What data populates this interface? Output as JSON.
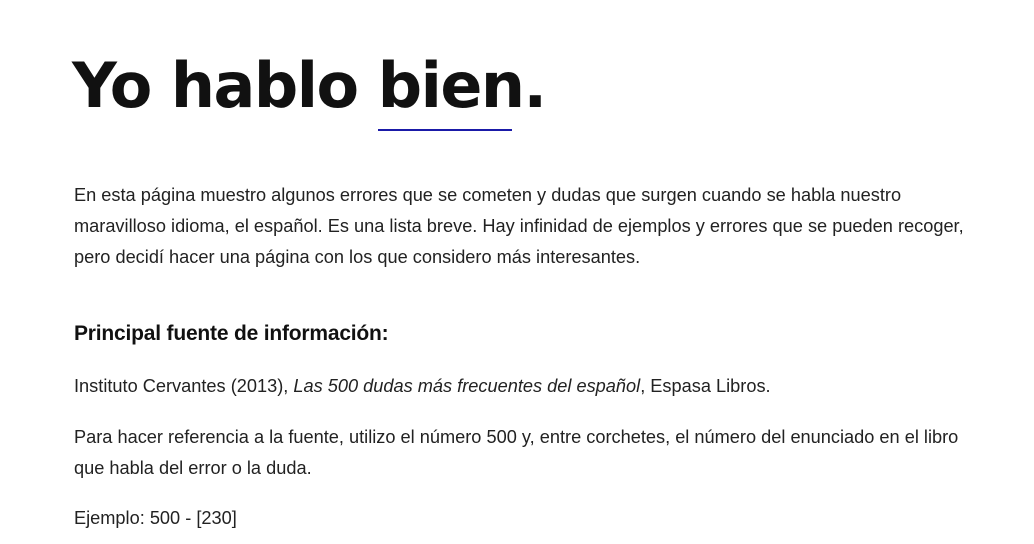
{
  "header": {
    "title_prefix": "Yo hablo ",
    "title_highlight": "bien",
    "title_suffix": ".",
    "accent_color": "#1a1aa8"
  },
  "intro": {
    "text": "En esta página muestro algunos errores que se cometen y dudas que surgen cuando se habla nuestro maravilloso idioma, el español. Es una lista breve. Hay infinidad de ejemplos y errores que se pueden recoger, pero decidí hacer una página con los que considero más interesantes."
  },
  "source_section": {
    "heading": "Principal fuente de información:",
    "citation_author": "Instituto Cervantes (2013), ",
    "citation_title": "Las 500 dudas más frecuentes del español",
    "citation_publisher": ", Espasa Libros.",
    "reference_note": "Para hacer referencia a la fuente, utilizo el número 500 y, entre corchetes, el número del enunciado en el libro que habla del error o la duda.",
    "example": "Ejemplo: 500 - [230]"
  }
}
